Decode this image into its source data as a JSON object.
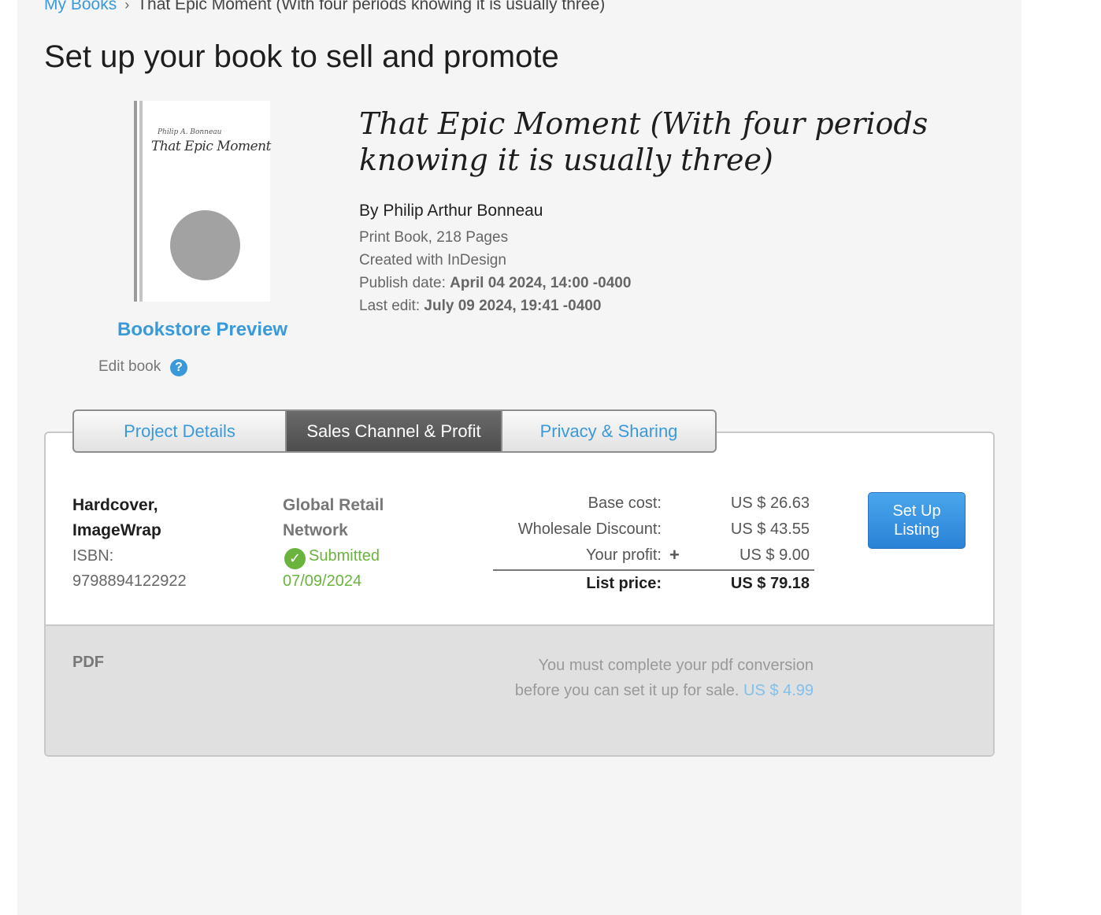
{
  "breadcrumb": {
    "root": "My Books",
    "separator": "›",
    "current": "That Epic Moment (With four periods knowing it is usually three)"
  },
  "page_title": "Set up your book to sell and promote",
  "cover": {
    "author_script": "Philip A. Bonneau",
    "title_script": "That Epic Moment"
  },
  "sidebar": {
    "bookstore_preview": "Bookstore Preview",
    "edit_book": "Edit book",
    "help_glyph": "?"
  },
  "book": {
    "title": "That Epic Moment (With four periods knowing it is usually three)",
    "by_line": "By Philip Arthur Bonneau",
    "format_pages": "Print Book, 218 Pages",
    "created_with": "Created with InDesign",
    "publish_label": "Publish date:",
    "publish_date": "April 04 2024, 14:00 -0400",
    "last_edit_label": "Last edit:",
    "last_edit_date": "July 09 2024, 19:41 -0400"
  },
  "tabs": {
    "project_details": "Project Details",
    "sales_channel": "Sales Channel & Profit",
    "privacy_sharing": "Privacy & Sharing",
    "active": "Sales Channel & Profit"
  },
  "listing": {
    "format_line1": "Hardcover,",
    "format_line2": "ImageWrap",
    "isbn_label": "ISBN:",
    "isbn": "9798894122922",
    "channel_line1": "Global Retail",
    "channel_line2": "Network",
    "status": "Submitted",
    "status_date": "07/09/2024",
    "base_cost_label": "Base cost:",
    "base_cost": "US $ 26.63",
    "wholesale_label": "Wholesale Discount:",
    "wholesale": "US $ 43.55",
    "profit_label": "Your profit:",
    "profit_icon": "+",
    "profit": "US $ 9.00",
    "list_price_label": "List price:",
    "list_price": "US $ 79.18",
    "setup_button": "Set Up Listing"
  },
  "pdf": {
    "label": "PDF",
    "message": "You must complete your pdf conversion before you can set it up for sale.",
    "price": "US $ 4.99"
  },
  "colors": {
    "link": "#3a9ad9",
    "success": "#6ab43e",
    "button": "#2a82d6",
    "active_tab": "#5a5a5a"
  }
}
